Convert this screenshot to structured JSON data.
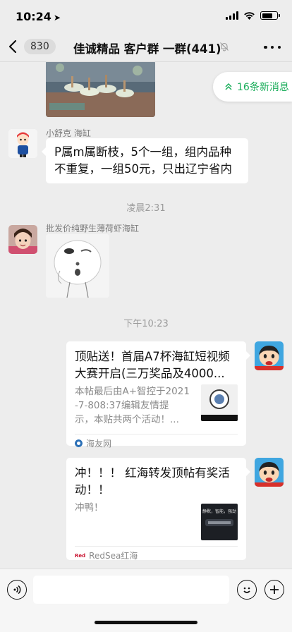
{
  "status_bar": {
    "time": "10:24",
    "location_glyph": "➤"
  },
  "nav": {
    "back_label": "830",
    "title": "佳诚精品 客户群 一群(441)"
  },
  "chat": {
    "new_messages_pill": "16条新消息",
    "messages": [
      {
        "sender": "小舒克 海缸",
        "text_line1": "P属m属断枝，5个一组，组内品种",
        "text_line2": "不重复，一组50元，只出辽宁省内"
      }
    ],
    "timestamp1": "凌晨2:31",
    "sender2": "批发价纯野生薄荷虾海缸",
    "timestamp2": "下午10:23",
    "card1": {
      "title_line1": "顶贴送！首届A7杯海缸短视频",
      "title_line2": "大赛开启(三万奖品及4000...",
      "desc_line1": "本帖最后由A+智控于2021",
      "desc_line2": "-7-808:37编辑友情提",
      "desc_line3": "示，本贴共两个活动！...",
      "source": "海友网"
    },
    "card2": {
      "title_line1": "冲！！！ 红海转发顶帖有奖活",
      "title_line2": "动！！",
      "desc": "冲鸭！",
      "thumb_text": "静默，智能，强劲",
      "source": "RedSea红海",
      "source_logo_text": "Red"
    }
  },
  "input": {
    "value": "",
    "placeholder": ""
  },
  "colors": {
    "accent_green": "#1aad5a",
    "background": "#ededed"
  }
}
